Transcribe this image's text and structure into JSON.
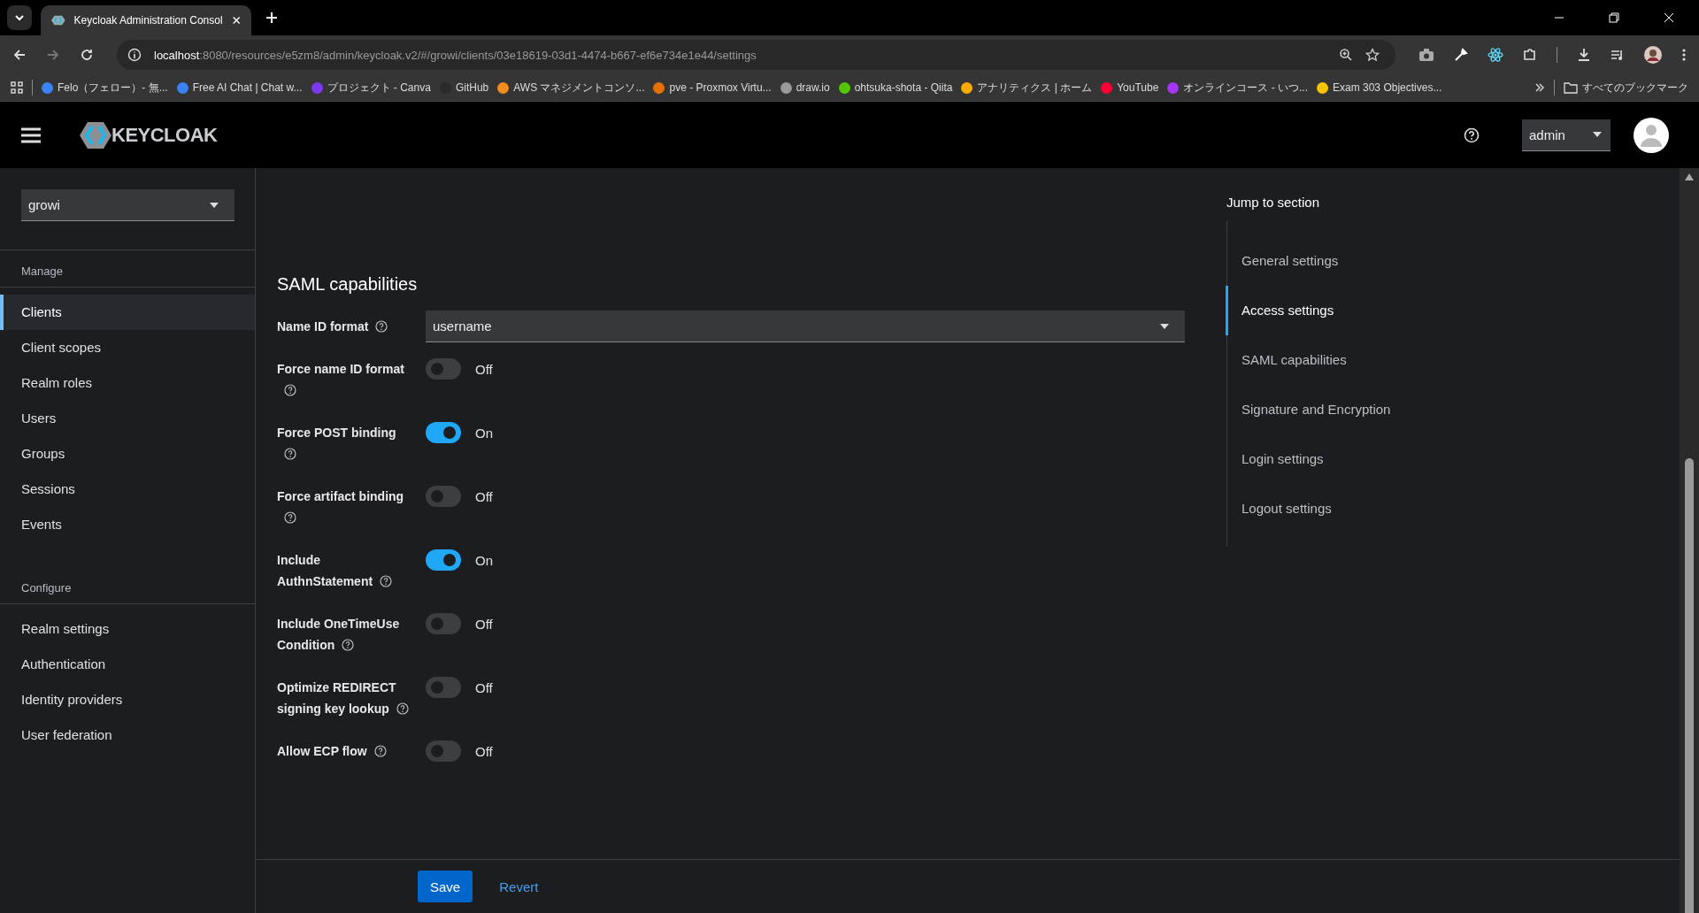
{
  "browser": {
    "tab_title": "Keycloak Administration Consol",
    "url_host": "localhost",
    "url_rest": ":8080/resources/e5zm8/admin/keycloak.v2/#/growi/clients/03e18619-03d1-4474-b667-ef6e734e1e44/settings",
    "bookmarks": [
      {
        "label": "Felo（フェロー）- 無...",
        "color": "#3b82f6"
      },
      {
        "label": "Free AI Chat | Chat w...",
        "color": "#3b82f6"
      },
      {
        "label": "プロジェクト - Canva",
        "color": "#7c3aed"
      },
      {
        "label": "GitHub",
        "color": "#2b2b2b"
      },
      {
        "label": "AWS マネジメントコンソ...",
        "color": "#f28c1b"
      },
      {
        "label": "pve - Proxmox Virtu...",
        "color": "#e57000"
      },
      {
        "label": "draw.io",
        "color": "#9a9a9a"
      },
      {
        "label": "ohtsuka-shota - Qiita",
        "color": "#55c500"
      },
      {
        "label": "アナリティクス | ホーム",
        "color": "#f9ab00"
      },
      {
        "label": "YouTube",
        "color": "#ff0033"
      },
      {
        "label": "オンラインコース - いつ...",
        "color": "#a435f0"
      },
      {
        "label": "Exam 303 Objectives...",
        "color": "#f5c400"
      }
    ],
    "all_bookmarks": "すべてのブックマーク"
  },
  "header": {
    "brand": "KEYCLOAK",
    "user": "admin"
  },
  "sidebar": {
    "realm": "growi",
    "sections": [
      {
        "heading": "Manage",
        "items": [
          {
            "label": "Clients",
            "selected": true
          },
          {
            "label": "Client scopes",
            "selected": false
          },
          {
            "label": "Realm roles",
            "selected": false
          },
          {
            "label": "Users",
            "selected": false
          },
          {
            "label": "Groups",
            "selected": false
          },
          {
            "label": "Sessions",
            "selected": false
          },
          {
            "label": "Events",
            "selected": false
          }
        ]
      },
      {
        "heading": "Configure",
        "items": [
          {
            "label": "Realm settings",
            "selected": false
          },
          {
            "label": "Authentication",
            "selected": false
          },
          {
            "label": "Identity providers",
            "selected": false
          },
          {
            "label": "User federation",
            "selected": false
          }
        ]
      }
    ]
  },
  "section": {
    "title": "SAML capabilities",
    "fields": [
      {
        "kind": "select",
        "label": "Name ID format",
        "value": "username"
      },
      {
        "kind": "switch",
        "label": "Force name ID format",
        "on": false,
        "state": "Off"
      },
      {
        "kind": "switch",
        "label": "Force POST binding",
        "on": true,
        "state": "On"
      },
      {
        "kind": "switch",
        "label": "Force artifact binding",
        "on": false,
        "state": "Off"
      },
      {
        "kind": "switch",
        "label": "Include AuthnStatement",
        "on": true,
        "state": "On"
      },
      {
        "kind": "switch",
        "label": "Include OneTimeUse Condition",
        "on": false,
        "state": "Off"
      },
      {
        "kind": "switch",
        "label": "Optimize REDIRECT signing key lookup",
        "on": false,
        "state": "Off"
      },
      {
        "kind": "switch",
        "label": "Allow ECP flow",
        "on": false,
        "state": "Off"
      }
    ]
  },
  "jump": {
    "title": "Jump to section",
    "items": [
      {
        "label": "General settings",
        "selected": false
      },
      {
        "label": "Access settings",
        "selected": true
      },
      {
        "label": "SAML capabilities",
        "selected": false
      },
      {
        "label": "Signature and Encryption",
        "selected": false
      },
      {
        "label": "Login settings",
        "selected": false
      },
      {
        "label": "Logout settings",
        "selected": false
      }
    ]
  },
  "footer": [
    {
      "kind": "primary",
      "label": "Save"
    },
    {
      "kind": "link",
      "label": "Revert"
    }
  ]
}
